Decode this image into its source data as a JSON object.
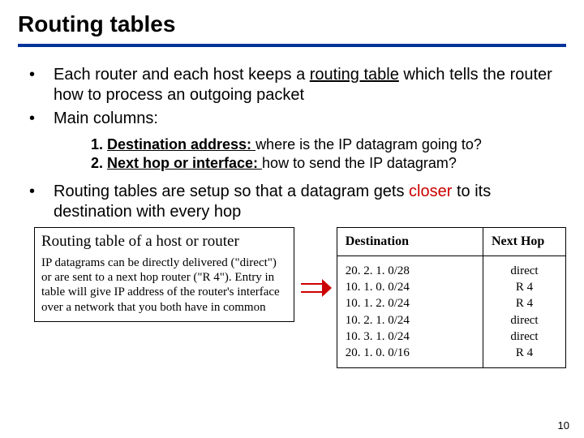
{
  "title": "Routing tables",
  "bullets": {
    "b1_pre": "Each router and each host keeps a ",
    "b1_u": "routing table",
    "b1_post": " which tells the router how to process an outgoing  packet",
    "b2": "Main columns:",
    "b3_pre": "Routing tables are setup so that a datagram gets ",
    "b3_red": "closer",
    "b3_post": " to its destination with every hop"
  },
  "numbered": {
    "n1_num": "1.   ",
    "n1_lead": "Destination address: ",
    "n1_tail": "where is the IP datagram going to?",
    "n2_num": "2.   ",
    "n2_lead": "Next hop or interface: ",
    "n2_tail": "how to send the IP datagram?"
  },
  "leftbox": {
    "heading": "Routing table of a host or router",
    "para": "IP datagrams can be directly delivered (\"direct\") or are sent to a next hop router (\"R 4\"). Entry in table will give IP address of the router's interface over a network that you both have in common"
  },
  "table": {
    "th_dest": "Destination",
    "th_next": "Next Hop",
    "dest0": "20. 2. 1. 0/28",
    "dest1": "10. 1. 0. 0/24",
    "dest2": "10. 1. 2. 0/24",
    "dest3": "10. 2. 1. 0/24",
    "dest4": "10. 3. 1. 0/24",
    "dest5": "20. 1. 0. 0/16",
    "next0": "direct",
    "next1": "R 4",
    "next2": "R 4",
    "next3": "direct",
    "next4": "direct",
    "next5": "R 4"
  },
  "page_number": "10",
  "chart_data": {
    "type": "table",
    "columns": [
      "Destination",
      "Next Hop"
    ],
    "rows": [
      [
        "20. 2. 1. 0/28",
        "direct"
      ],
      [
        "10. 1. 0. 0/24",
        "R 4"
      ],
      [
        "10. 1. 2. 0/24",
        "R 4"
      ],
      [
        "10. 2. 1. 0/24",
        "direct"
      ],
      [
        "10. 3. 1. 0/24",
        "direct"
      ],
      [
        "20. 1. 0. 0/16",
        "R 4"
      ]
    ]
  }
}
